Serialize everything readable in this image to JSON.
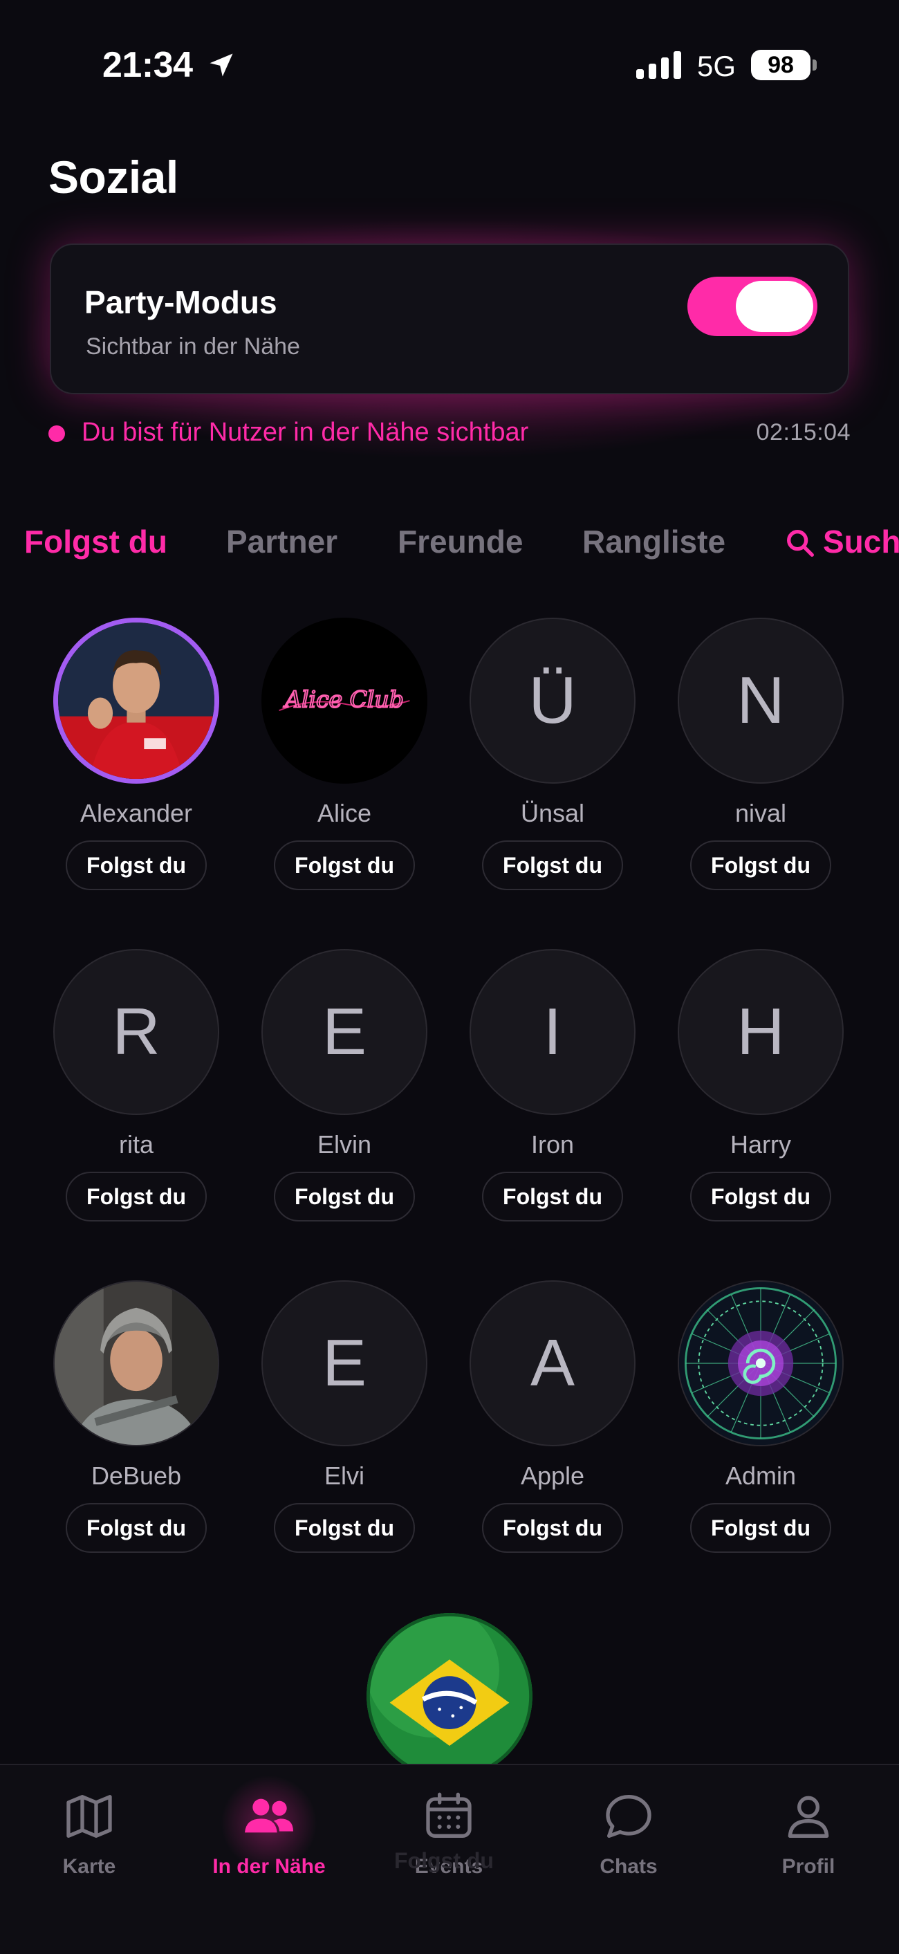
{
  "status_bar": {
    "time": "21:34",
    "network": "5G",
    "battery": "98"
  },
  "page": {
    "title": "Sozial"
  },
  "party_mode": {
    "title": "Party-Modus",
    "subtitle": "Sichtbar in der Nähe",
    "enabled": true,
    "visibility_text": "Du bist für Nutzer in der Nähe sichtbar",
    "timer": "02:15:04"
  },
  "tabs": [
    {
      "label": "Folgst du",
      "active": true
    },
    {
      "label": "Partner",
      "active": false
    },
    {
      "label": "Freunde",
      "active": false
    },
    {
      "label": "Rangliste",
      "active": false
    }
  ],
  "search_tab": {
    "label": "Such",
    "icon": "search-icon"
  },
  "users": [
    {
      "name": "Alexander",
      "initial": "",
      "photo": "player-photo",
      "button": "Folgst du"
    },
    {
      "name": "Alice",
      "initial": "",
      "photo": "alice-club-logo",
      "logo_text": "Alice Club",
      "button": "Folgst du"
    },
    {
      "name": "Ünsal",
      "initial": "Ü",
      "button": "Folgst du"
    },
    {
      "name": "nival",
      "initial": "N",
      "button": "Folgst du"
    },
    {
      "name": "rita",
      "initial": "R",
      "button": "Folgst du"
    },
    {
      "name": "Elvin",
      "initial": "E",
      "button": "Folgst du"
    },
    {
      "name": "Iron",
      "initial": "I",
      "button": "Folgst du"
    },
    {
      "name": "Harry",
      "initial": "H",
      "button": "Folgst du"
    },
    {
      "name": "DeBueb",
      "initial": "",
      "photo": "selfie-photo",
      "button": "Folgst du"
    },
    {
      "name": "Elvi",
      "initial": "E",
      "button": "Folgst du"
    },
    {
      "name": "Apple",
      "initial": "A",
      "button": "Folgst du"
    },
    {
      "name": "Admin",
      "initial": "",
      "photo": "mandala-image",
      "button": "Folgst du"
    }
  ],
  "floating_ball": {
    "icon": "brazil-soccer-ball"
  },
  "bottom_nav": [
    {
      "label": "Karte",
      "icon": "map-icon",
      "active": false
    },
    {
      "label": "In der Nähe",
      "icon": "people-icon",
      "active": true
    },
    {
      "label": "Events",
      "icon": "calendar-icon",
      "active": false
    },
    {
      "label": "Chats",
      "icon": "chat-icon",
      "active": false
    },
    {
      "label": "Profil",
      "icon": "profile-icon",
      "active": false
    }
  ],
  "ghost_label": "Folgst du",
  "colors": {
    "accent": "#ff2ba8",
    "ring": "#a35cf2",
    "background": "#0b0a10"
  }
}
